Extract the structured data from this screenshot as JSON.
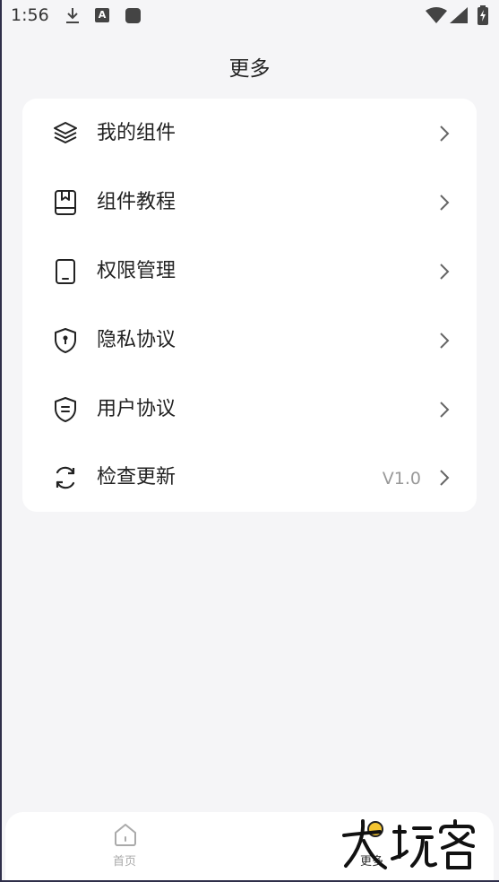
{
  "status_bar": {
    "time": "1:56",
    "icons": [
      "download-icon",
      "a-notification-icon",
      "square-notification-icon",
      "wifi-icon",
      "signal-icon",
      "battery-icon"
    ]
  },
  "header": {
    "title": "更多"
  },
  "menu": {
    "items": [
      {
        "label": "我的组件",
        "icon": "layers-icon"
      },
      {
        "label": "组件教程",
        "icon": "bookmark-book-icon"
      },
      {
        "label": "权限管理",
        "icon": "tablet-icon"
      },
      {
        "label": "隐私协议",
        "icon": "shield-lock-icon"
      },
      {
        "label": "用户协议",
        "icon": "shield-document-icon"
      },
      {
        "label": "检查更新",
        "icon": "refresh-icon",
        "value": "V1.0"
      }
    ]
  },
  "bottom_nav": {
    "tabs": [
      {
        "label": "首页",
        "icon": "home-icon",
        "active": false
      },
      {
        "label": "更多",
        "icon": "more-icon",
        "active": true
      }
    ]
  },
  "watermark": {
    "text": "大玩客"
  },
  "colors": {
    "background": "#f5f5f7",
    "card": "#ffffff",
    "text": "#222222",
    "muted": "#999999",
    "inactive_tab": "#aaaaaa"
  }
}
